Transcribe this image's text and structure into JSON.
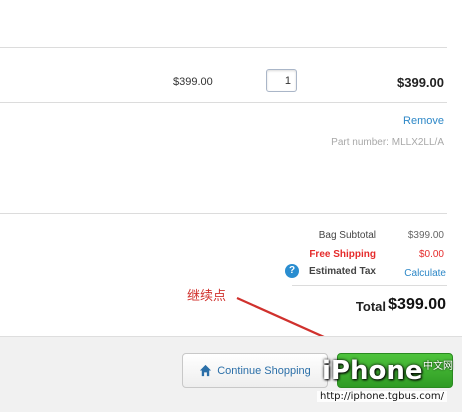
{
  "item": {
    "price": "$399.00",
    "quantity": "1",
    "line_total": "$399.00",
    "remove_label": "Remove",
    "part_number": "Part number: MLLX2LL/A"
  },
  "summary": {
    "bag_subtotal_label": "Bag Subtotal",
    "bag_subtotal_value": "$399.00",
    "shipping_label": "Free Shipping",
    "shipping_value": "$0.00",
    "tax_help_glyph": "?",
    "tax_label": "Estimated Tax",
    "tax_action": "Calculate",
    "total_label": "Total",
    "total_value": "$399.00"
  },
  "annotation": {
    "text": "继续点"
  },
  "footer": {
    "continue_label": "Continue Shopping",
    "checkout_label": ""
  },
  "watermark": {
    "logo": "iPhone",
    "cn": "中文网",
    "url": "http://iphone.tgbus.com/"
  },
  "colors": {
    "link": "#2c87c7",
    "shipping_red": "#e52b2b",
    "checkout_green": "#3aad2e",
    "annotation_red": "#d0312d"
  },
  "icons": [
    "home-icon",
    "help-icon",
    "arrow-annotation"
  ]
}
